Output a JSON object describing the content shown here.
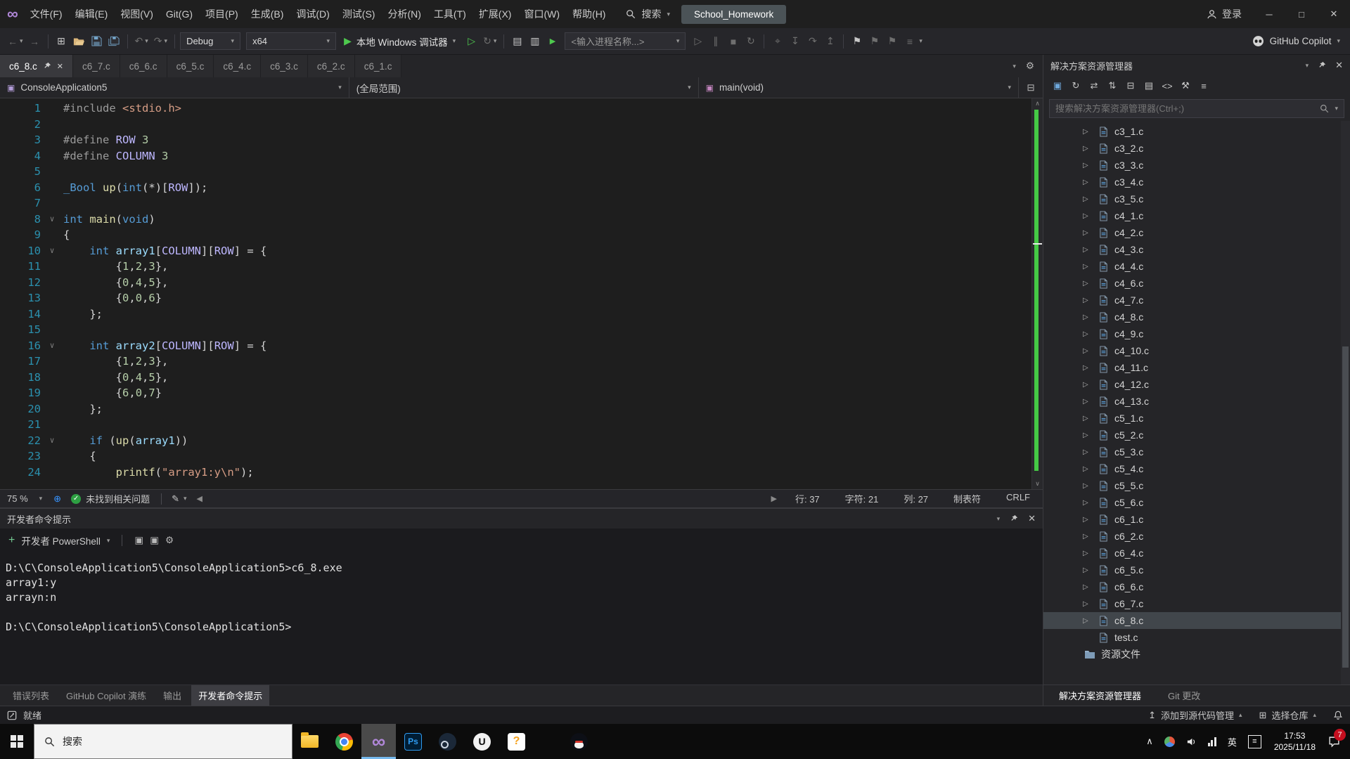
{
  "colors": {
    "run_green": "#4ec94e",
    "change_mark_green": "#45c945",
    "selection_bg": "#41464b",
    "macro_purple": "#beb7ff"
  },
  "icons": {
    "caret_down": "▾",
    "caret_up": "▴",
    "fold": "∨",
    "tree_chevron": "▷",
    "close": "✕",
    "minimize": "─",
    "maximize": "□",
    "check": "✓",
    "gear": "⚙",
    "flag": "⚑",
    "play": "▶",
    "play_outline": "▷",
    "stop": "■",
    "pause": "∥",
    "undo": "↶",
    "redo": "↷",
    "back": "←",
    "forward": "→",
    "restart": "↻",
    "grid": "⊞",
    "collapse": "⊟",
    "rows": "▤",
    "columns": "▥",
    "views": "▣",
    "compare": "⇄",
    "swap": "⇅",
    "code": "<>",
    "wrench": "⚒",
    "list": "≡",
    "step_into": "↧",
    "step_over": "↷",
    "step_out": "↥",
    "target": "⌖",
    "chev_up": "∧",
    "chev_down": "∨",
    "plus": "+",
    "globe": "⊕",
    "pen": "✎"
  },
  "title_bar": {
    "menus": [
      "文件(F)",
      "编辑(E)",
      "视图(V)",
      "Git(G)",
      "项目(P)",
      "生成(B)",
      "调试(D)",
      "测试(S)",
      "分析(N)",
      "工具(T)",
      "扩展(X)",
      "窗口(W)",
      "帮助(H)"
    ],
    "search_label": "搜索",
    "solution_name": "School_Homework",
    "sign_in": "登录"
  },
  "toolbar": {
    "config": "Debug",
    "platform": "x64",
    "run_label": "本地 Windows 调试器",
    "process_placeholder": "<输入进程名称...>",
    "copilot_label": "GitHub Copilot"
  },
  "editor": {
    "tabs": [
      {
        "label": "c6_8.c",
        "active": true
      },
      {
        "label": "c6_7.c"
      },
      {
        "label": "c6_6.c"
      },
      {
        "label": "c6_5.c"
      },
      {
        "label": "c6_4.c"
      },
      {
        "label": "c6_3.c"
      },
      {
        "label": "c6_2.c"
      },
      {
        "label": "c6_1.c"
      }
    ],
    "nav": {
      "project": "ConsoleApplication5",
      "scope": "(全局范围)",
      "member": "main(void)"
    }
  },
  "code": {
    "lines": [
      {
        "n": 1,
        "t": [
          [
            "pp",
            "#include "
          ],
          [
            "str",
            "<stdio.h>"
          ]
        ]
      },
      {
        "n": 2,
        "t": []
      },
      {
        "n": 3,
        "t": [
          [
            "pp",
            "#define "
          ],
          [
            "mac",
            "ROW"
          ],
          [
            "pl",
            " "
          ],
          [
            "num",
            "3"
          ]
        ]
      },
      {
        "n": 4,
        "t": [
          [
            "pp",
            "#define "
          ],
          [
            "mac",
            "COLUMN"
          ],
          [
            "pl",
            " "
          ],
          [
            "num",
            "3"
          ]
        ]
      },
      {
        "n": 5,
        "t": []
      },
      {
        "n": 6,
        "t": [
          [
            "kw",
            "_Bool"
          ],
          [
            "pl",
            " "
          ],
          [
            "fn",
            "up"
          ],
          [
            "pl",
            "("
          ],
          [
            "kw",
            "int"
          ],
          [
            "pl",
            "(*)["
          ],
          [
            "mac",
            "ROW"
          ],
          [
            "pl",
            "]);"
          ]
        ]
      },
      {
        "n": 7,
        "t": []
      },
      {
        "n": 8,
        "fold": true,
        "t": [
          [
            "kw",
            "int"
          ],
          [
            "pl",
            " "
          ],
          [
            "fn",
            "main"
          ],
          [
            "pl",
            "("
          ],
          [
            "kw",
            "void"
          ],
          [
            "pl",
            ")"
          ]
        ]
      },
      {
        "n": 9,
        "t": [
          [
            "pl",
            "{"
          ]
        ]
      },
      {
        "n": 10,
        "fold": true,
        "t": [
          [
            "pl",
            "    "
          ],
          [
            "kw",
            "int"
          ],
          [
            "pl",
            " "
          ],
          [
            "var",
            "array1"
          ],
          [
            "pl",
            "["
          ],
          [
            "mac",
            "COLUMN"
          ],
          [
            "pl",
            "]["
          ],
          [
            "mac",
            "ROW"
          ],
          [
            "pl",
            "] = {"
          ]
        ]
      },
      {
        "n": 11,
        "t": [
          [
            "pl",
            "        {"
          ],
          [
            "num",
            "1"
          ],
          [
            "pl",
            ","
          ],
          [
            "num",
            "2"
          ],
          [
            "pl",
            ","
          ],
          [
            "num",
            "3"
          ],
          [
            "pl",
            "},"
          ]
        ]
      },
      {
        "n": 12,
        "t": [
          [
            "pl",
            "        {"
          ],
          [
            "num",
            "0"
          ],
          [
            "pl",
            ","
          ],
          [
            "num",
            "4"
          ],
          [
            "pl",
            ","
          ],
          [
            "num",
            "5"
          ],
          [
            "pl",
            "},"
          ]
        ]
      },
      {
        "n": 13,
        "t": [
          [
            "pl",
            "        {"
          ],
          [
            "num",
            "0"
          ],
          [
            "pl",
            ","
          ],
          [
            "num",
            "0"
          ],
          [
            "pl",
            ","
          ],
          [
            "num",
            "6"
          ],
          [
            "pl",
            "}"
          ]
        ]
      },
      {
        "n": 14,
        "t": [
          [
            "pl",
            "    };"
          ]
        ]
      },
      {
        "n": 15,
        "t": []
      },
      {
        "n": 16,
        "fold": true,
        "t": [
          [
            "pl",
            "    "
          ],
          [
            "kw",
            "int"
          ],
          [
            "pl",
            " "
          ],
          [
            "var",
            "array2"
          ],
          [
            "pl",
            "["
          ],
          [
            "mac",
            "COLUMN"
          ],
          [
            "pl",
            "]["
          ],
          [
            "mac",
            "ROW"
          ],
          [
            "pl",
            "] = {"
          ]
        ]
      },
      {
        "n": 17,
        "t": [
          [
            "pl",
            "        {"
          ],
          [
            "num",
            "1"
          ],
          [
            "pl",
            ","
          ],
          [
            "num",
            "2"
          ],
          [
            "pl",
            ","
          ],
          [
            "num",
            "3"
          ],
          [
            "pl",
            "},"
          ]
        ]
      },
      {
        "n": 18,
        "t": [
          [
            "pl",
            "        {"
          ],
          [
            "num",
            "0"
          ],
          [
            "pl",
            ","
          ],
          [
            "num",
            "4"
          ],
          [
            "pl",
            ","
          ],
          [
            "num",
            "5"
          ],
          [
            "pl",
            "},"
          ]
        ]
      },
      {
        "n": 19,
        "t": [
          [
            "pl",
            "        {"
          ],
          [
            "num",
            "6"
          ],
          [
            "pl",
            ","
          ],
          [
            "num",
            "0"
          ],
          [
            "pl",
            ","
          ],
          [
            "num",
            "7"
          ],
          [
            "pl",
            "}"
          ]
        ]
      },
      {
        "n": 20,
        "t": [
          [
            "pl",
            "    };"
          ]
        ]
      },
      {
        "n": 21,
        "t": []
      },
      {
        "n": 22,
        "fold": true,
        "t": [
          [
            "pl",
            "    "
          ],
          [
            "kw",
            "if"
          ],
          [
            "pl",
            " ("
          ],
          [
            "fn",
            "up"
          ],
          [
            "pl",
            "("
          ],
          [
            "var",
            "array1"
          ],
          [
            "pl",
            "))"
          ]
        ]
      },
      {
        "n": 23,
        "t": [
          [
            "pl",
            "    {"
          ]
        ]
      },
      {
        "n": 24,
        "t": [
          [
            "pl",
            "        "
          ],
          [
            "fn",
            "printf"
          ],
          [
            "pl",
            "("
          ],
          [
            "str",
            "\"array1:y\\n\""
          ],
          [
            "pl",
            ");"
          ]
        ]
      }
    ]
  },
  "editor_status": {
    "zoom": "75 %",
    "health": "未找到相关问题",
    "line": "行: 37",
    "chars": "字符: 21",
    "col": "列: 27",
    "tabs_label": "制表符",
    "eol": "CRLF"
  },
  "terminal": {
    "title": "开发者命令提示",
    "shell_label": "开发者 PowerShell",
    "lines": [
      "D:\\C\\ConsoleApplication5\\ConsoleApplication5>c6_8.exe",
      "array1:y",
      "arrayn:n",
      "",
      "D:\\C\\ConsoleApplication5\\ConsoleApplication5>"
    ]
  },
  "bottom_tabs": [
    {
      "label": "错误列表"
    },
    {
      "label": "GitHub Copilot 演练"
    },
    {
      "label": "输出"
    },
    {
      "label": "开发者命令提示",
      "active": true
    }
  ],
  "solution_explorer": {
    "title": "解决方案资源管理器",
    "search_placeholder": "搜索解决方案资源管理器(Ctrl+;)",
    "files": [
      {
        "name": "c3_1.c"
      },
      {
        "name": "c3_2.c"
      },
      {
        "name": "c3_3.c"
      },
      {
        "name": "c3_4.c"
      },
      {
        "name": "c3_5.c"
      },
      {
        "name": "c4_1.c"
      },
      {
        "name": "c4_2.c"
      },
      {
        "name": "c4_3.c"
      },
      {
        "name": "c4_4.c"
      },
      {
        "name": "c4_6.c"
      },
      {
        "name": "c4_7.c"
      },
      {
        "name": "c4_8.c"
      },
      {
        "name": "c4_9.c"
      },
      {
        "name": "c4_10.c"
      },
      {
        "name": "c4_11.c"
      },
      {
        "name": "c4_12.c"
      },
      {
        "name": "c4_13.c"
      },
      {
        "name": "c5_1.c"
      },
      {
        "name": "c5_2.c"
      },
      {
        "name": "c5_3.c"
      },
      {
        "name": "c5_4.c"
      },
      {
        "name": "c5_5.c"
      },
      {
        "name": "c5_6.c"
      },
      {
        "name": "c6_1.c"
      },
      {
        "name": "c6_2.c"
      },
      {
        "name": "c6_4.c"
      },
      {
        "name": "c6_5.c"
      },
      {
        "name": "c6_6.c"
      },
      {
        "name": "c6_7.c"
      },
      {
        "name": "c6_8.c",
        "selected": true
      },
      {
        "name": "test.c",
        "chevron": false
      },
      {
        "name": "资源文件",
        "folder": true,
        "chevron": false,
        "top": true
      }
    ],
    "bottom_tabs": [
      {
        "label": "解决方案资源管理器",
        "active": true
      },
      {
        "label": "Git 更改"
      }
    ]
  },
  "status_bar": {
    "ready": "就绪",
    "add_to_source": "添加到源代码管理",
    "select_repo": "选择仓库"
  },
  "taskbar": {
    "search_label": "搜索",
    "lang": "英",
    "time": "17:53",
    "date": "2025/11/18",
    "notification_count": "7"
  }
}
